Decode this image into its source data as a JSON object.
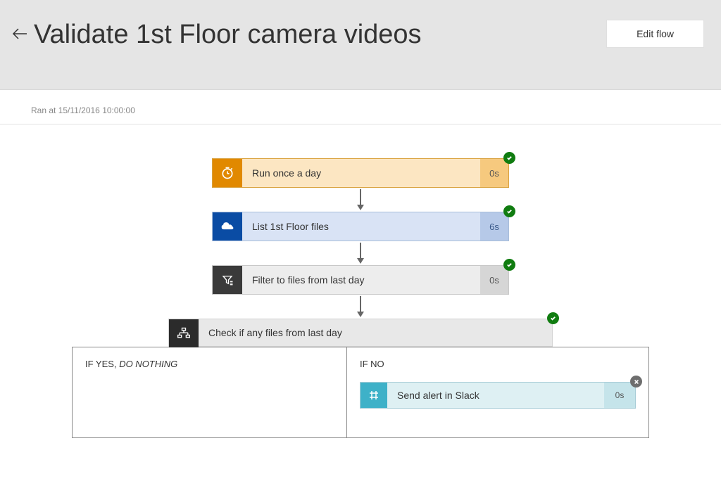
{
  "header": {
    "title": "Validate 1st Floor camera videos",
    "edit_button": "Edit flow"
  },
  "run_info": "Ran at 15/11/2016 10:00:00",
  "steps": [
    {
      "label": "Run once a day",
      "duration": "0s",
      "icon": "clock-icon",
      "status": "success"
    },
    {
      "label": "List 1st Floor files",
      "duration": "6s",
      "icon": "cloud-icon",
      "status": "success"
    },
    {
      "label": "Filter to files from last day",
      "duration": "0s",
      "icon": "filter-icon",
      "status": "success"
    }
  ],
  "condition": {
    "label": "Check if any files from last day",
    "icon": "condition-icon",
    "status": "success",
    "yes_label": "IF YES,",
    "yes_suffix": "DO NOTHING",
    "no_label": "IF NO",
    "no_step": {
      "label": "Send alert in Slack",
      "duration": "0s",
      "icon": "slack-icon",
      "status": "cancelled"
    }
  }
}
